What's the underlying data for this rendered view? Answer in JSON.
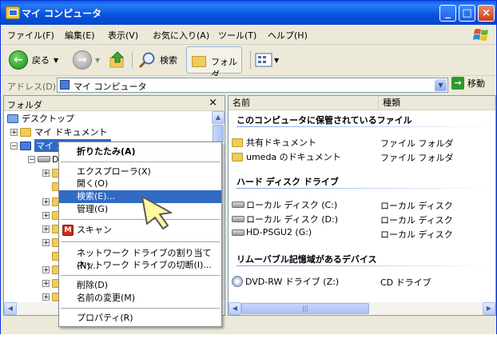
{
  "window": {
    "title": "マイ コンピュータ"
  },
  "menubar": {
    "items": [
      "ファイル(F)",
      "編集(E)",
      "表示(V)",
      "お気に入り(A)",
      "ツール(T)",
      "ヘルプ(H)"
    ]
  },
  "toolbar": {
    "back_label": "戻る",
    "search_label": "検索",
    "folders_label": "フォルダ"
  },
  "address": {
    "label": "アドレス(D)",
    "value": "マイ コンピュータ",
    "go_label": "移動"
  },
  "folder_pane": {
    "header": "フォルダ",
    "close_glyph": "×",
    "tree": [
      {
        "label": "デスクトップ",
        "expander": ""
      },
      {
        "label": "マイ ドキュメント",
        "expander": "+"
      },
      {
        "label": "マイ コンピュータ",
        "expander": "−"
      },
      {
        "label": "D",
        "expander": "−"
      }
    ]
  },
  "file_pane": {
    "columns": [
      "名前",
      "種類"
    ],
    "groups": [
      {
        "title": "このコンピュータに保管されているファイル",
        "items": [
          {
            "name": "共有ドキュメント",
            "type": "ファイル フォルダ"
          },
          {
            "name": "umeda のドキュメント",
            "type": "ファイル フォルダ"
          }
        ]
      },
      {
        "title": "ハード ディスク ドライブ",
        "items": [
          {
            "name": "ローカル ディスク (C:)",
            "type": "ローカル ディスク"
          },
          {
            "name": "ローカル ディスク (D:)",
            "type": "ローカル ディスク"
          },
          {
            "name": "HD-PSGU2 (G:)",
            "type": "ローカル ディスク"
          }
        ]
      },
      {
        "title": "リムーバブル記憶域があるデバイス",
        "items": [
          {
            "name": "DVD-RW ドライブ (Z:)",
            "type": "CD ドライブ"
          }
        ]
      }
    ]
  },
  "context_menu": {
    "items": [
      {
        "label": "折りたたみ(A)",
        "bold": true
      },
      {
        "label": "エクスプローラ(X)"
      },
      {
        "label": "開く(O)"
      },
      {
        "label": "検索(E)...",
        "highlighted": true
      },
      {
        "label": "管理(G)"
      },
      {
        "label": "スキャン"
      },
      {
        "label": "ネットワーク ドライブの割り当て(N)..."
      },
      {
        "label": "ネットワーク ドライブの切断(I)..."
      },
      {
        "label": "削除(D)"
      },
      {
        "label": "名前の変更(M)"
      },
      {
        "label": "プロパティ(R)"
      }
    ]
  },
  "colors": {
    "title_bar": "#0a5fe8",
    "highlight": "#316ac5",
    "chrome": "#ece9d8"
  }
}
